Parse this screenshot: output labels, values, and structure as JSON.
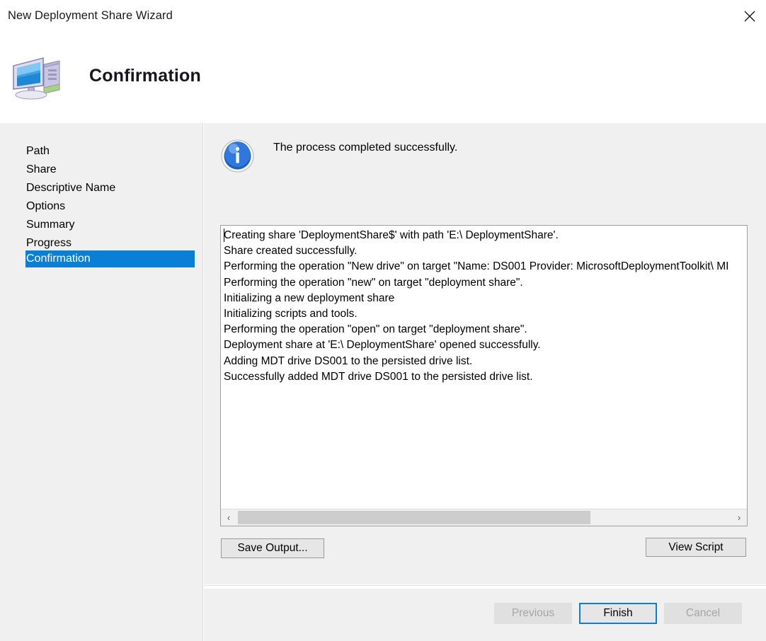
{
  "window": {
    "title": "New Deployment Share Wizard",
    "close_icon": "close-icon"
  },
  "header": {
    "page_title": "Confirmation",
    "icon": "computer-monitor-icon"
  },
  "sidebar": {
    "items": [
      {
        "label": "Path",
        "selected": false
      },
      {
        "label": "Share",
        "selected": false
      },
      {
        "label": "Descriptive Name",
        "selected": false
      },
      {
        "label": "Options",
        "selected": false
      },
      {
        "label": "Summary",
        "selected": false
      },
      {
        "label": "Progress",
        "selected": false
      },
      {
        "label": "Confirmation",
        "selected": true
      }
    ],
    "selected_color": "#0a7fd6"
  },
  "content": {
    "status": {
      "icon": "info-circle-icon",
      "message": "The process completed successfully."
    },
    "output": {
      "lines": [
        "Creating share 'DeploymentShare$' with path 'E:\\ DeploymentShare'.",
        "Share created successfully.",
        "Performing the operation \"New drive\" on target \"Name: DS001 Provider: MicrosoftDeploymentToolkit\\ MI",
        "Performing the operation \"new\" on target \"deployment share\".",
        "Initializing a new deployment share",
        "Initializing scripts and tools.",
        "Performing the operation \"open\" on target \"deployment share\".",
        "Deployment share at 'E:\\ DeploymentShare' opened successfully.",
        "Adding MDT drive DS001 to the persisted drive list.",
        "Successfully added MDT drive DS001 to the persisted drive list."
      ],
      "scrollbar": {
        "left_arrow": "chevron-left-icon",
        "right_arrow": "chevron-right-icon"
      }
    },
    "save_output_label": "Save Output...",
    "view_script_label": "View Script"
  },
  "footer": {
    "previous_label": "Previous",
    "finish_label": "Finish",
    "cancel_label": "Cancel"
  }
}
